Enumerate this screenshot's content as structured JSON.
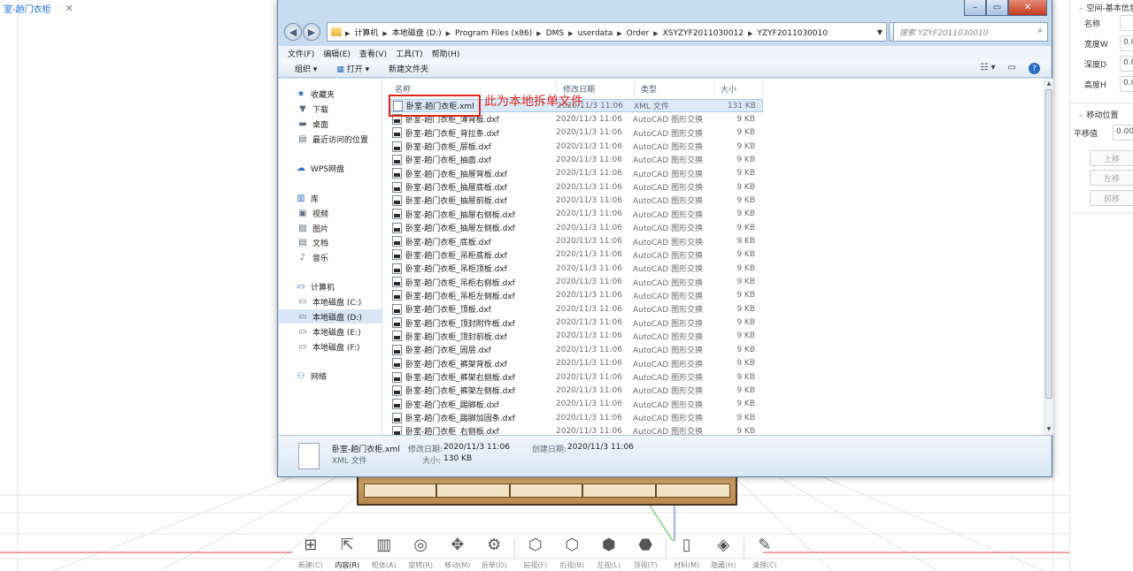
{
  "app": {
    "doc_tab": {
      "label": "室-趟门衣柜",
      "close": "✕"
    },
    "toolbar": [
      {
        "label": "新建(C)",
        "icon": "add-frame-icon",
        "glyph": "⊞"
      },
      {
        "label": "内容(R)",
        "icon": "select-cursor-icon",
        "glyph": "⇱",
        "active": true
      },
      {
        "label": "柜体(A)",
        "icon": "cabinet-icon",
        "glyph": "▥"
      },
      {
        "label": "旋转(R)",
        "icon": "rotate-icon",
        "glyph": "◎"
      },
      {
        "label": "移动(M)",
        "icon": "move-icon",
        "glyph": "✥"
      },
      {
        "label": "拆单(D)",
        "icon": "split-icon",
        "glyph": "⚙"
      },
      {
        "label": "前视(F)",
        "icon": "front-view-icon",
        "glyph": "⬡"
      },
      {
        "label": "后视(B)",
        "icon": "back-view-icon",
        "glyph": "⬡"
      },
      {
        "label": "左视(L)",
        "icon": "left-view-icon",
        "glyph": "⬢"
      },
      {
        "label": "顶视(T)",
        "icon": "top-view-icon",
        "glyph": "⬣"
      },
      {
        "label": "材料(M)",
        "icon": "material-icon",
        "glyph": "▯"
      },
      {
        "label": "隐藏(H)",
        "icon": "layers-icon",
        "glyph": "◈"
      },
      {
        "label": "清理(C)",
        "icon": "brush-icon",
        "glyph": "✎"
      }
    ]
  },
  "prop_panel": {
    "section1_title": "空间-基本信息",
    "fields": [
      {
        "label": "名称",
        "value": ""
      },
      {
        "label": "宽度W",
        "value": "0.0"
      },
      {
        "label": "深度D",
        "value": "0.0"
      },
      {
        "label": "高度H",
        "value": "0.0"
      }
    ],
    "section2_title": "移动位置",
    "offset_label": "平移值",
    "offset_value": "0.00",
    "buttons": [
      "上移",
      "左移",
      "前移"
    ]
  },
  "explorer": {
    "window_controls": {
      "min": "–",
      "max": "▭",
      "close": "✕"
    },
    "breadcrumbs": [
      "计算机",
      "本地磁盘 (D:)",
      "Program Files (x86)",
      "DMS",
      "userdata",
      "Order",
      "XSYZYF2011030012",
      "YZYF2011030010"
    ],
    "search_placeholder": "搜索 YZYF2011030010",
    "menu": [
      "文件(F)",
      "编辑(E)",
      "查看(V)",
      "工具(T)",
      "帮助(H)"
    ],
    "commands": {
      "organize": "组织 ▾",
      "open": "打开 ▾",
      "new_folder": "新建文件夹"
    },
    "nav": [
      {
        "label": "收藏夹",
        "icon": "star-icon",
        "glyph": "★",
        "head": true
      },
      {
        "label": "下载",
        "icon": "download-folder-icon",
        "glyph": "▼"
      },
      {
        "label": "桌面",
        "icon": "desktop-icon",
        "glyph": "▬"
      },
      {
        "label": "最近访问的位置",
        "icon": "recent-places-icon",
        "glyph": "▤"
      },
      {
        "label": "WPS网盘",
        "icon": "cloud-icon",
        "glyph": "☁",
        "head": true
      },
      {
        "label": "库",
        "icon": "library-icon",
        "glyph": "▥",
        "head": true
      },
      {
        "label": "视频",
        "icon": "video-icon",
        "glyph": "▣"
      },
      {
        "label": "图片",
        "icon": "picture-icon",
        "glyph": "▨"
      },
      {
        "label": "文档",
        "icon": "document-icon",
        "glyph": "▤"
      },
      {
        "label": "音乐",
        "icon": "music-icon",
        "glyph": "♪"
      },
      {
        "label": "计算机",
        "icon": "computer-icon",
        "glyph": "▭",
        "head": true
      },
      {
        "label": "本地磁盘 (C:)",
        "icon": "drive-icon",
        "glyph": "▭"
      },
      {
        "label": "本地磁盘 (D:)",
        "icon": "drive-icon",
        "glyph": "▭",
        "selected": true
      },
      {
        "label": "本地磁盘 (E:)",
        "icon": "drive-icon",
        "glyph": "▭"
      },
      {
        "label": "本地磁盘 (F:)",
        "icon": "drive-icon",
        "glyph": "▭"
      },
      {
        "label": "网络",
        "icon": "network-icon",
        "glyph": "⚇",
        "head": true
      }
    ],
    "columns": {
      "name": "名称",
      "date": "修改日期",
      "type": "类型",
      "size": "大小"
    },
    "files": [
      {
        "name": "卧室-趟门衣柜.xml",
        "date": "2020/11/3 11:06",
        "type": "XML 文件",
        "size": "131 KB",
        "kind": "xml",
        "selected": true
      },
      {
        "name": "卧室-趟门衣柜_薄背板.dxf",
        "date": "2020/11/3 11:06",
        "type": "AutoCAD 图形交换",
        "size": "9 KB",
        "kind": "dxf"
      },
      {
        "name": "卧室-趟门衣柜_背拉条.dxf",
        "date": "2020/11/3 11:06",
        "type": "AutoCAD 图形交换",
        "size": "9 KB",
        "kind": "dxf"
      },
      {
        "name": "卧室-趟门衣柜_层板.dxf",
        "date": "2020/11/3 11:06",
        "type": "AutoCAD 图形交换",
        "size": "9 KB",
        "kind": "dxf"
      },
      {
        "name": "卧室-趟门衣柜_抽面.dxf",
        "date": "2020/11/3 11:06",
        "type": "AutoCAD 图形交换",
        "size": "9 KB",
        "kind": "dxf"
      },
      {
        "name": "卧室-趟门衣柜_抽屉背板.dxf",
        "date": "2020/11/3 11:06",
        "type": "AutoCAD 图形交换",
        "size": "9 KB",
        "kind": "dxf"
      },
      {
        "name": "卧室-趟门衣柜_抽屉底板.dxf",
        "date": "2020/11/3 11:06",
        "type": "AutoCAD 图形交换",
        "size": "9 KB",
        "kind": "dxf"
      },
      {
        "name": "卧室-趟门衣柜_抽屉前板.dxf",
        "date": "2020/11/3 11:06",
        "type": "AutoCAD 图形交换",
        "size": "9 KB",
        "kind": "dxf"
      },
      {
        "name": "卧室-趟门衣柜_抽屉右侧板.dxf",
        "date": "2020/11/3 11:06",
        "type": "AutoCAD 图形交换",
        "size": "9 KB",
        "kind": "dxf"
      },
      {
        "name": "卧室-趟门衣柜_抽屉左侧板.dxf",
        "date": "2020/11/3 11:06",
        "type": "AutoCAD 图形交换",
        "size": "9 KB",
        "kind": "dxf"
      },
      {
        "name": "卧室-趟门衣柜_底板.dxf",
        "date": "2020/11/3 11:06",
        "type": "AutoCAD 图形交换",
        "size": "9 KB",
        "kind": "dxf"
      },
      {
        "name": "卧室-趟门衣柜_吊柜底板.dxf",
        "date": "2020/11/3 11:06",
        "type": "AutoCAD 图形交换",
        "size": "9 KB",
        "kind": "dxf"
      },
      {
        "name": "卧室-趟门衣柜_吊柜顶板.dxf",
        "date": "2020/11/3 11:06",
        "type": "AutoCAD 图形交换",
        "size": "9 KB",
        "kind": "dxf"
      },
      {
        "name": "卧室-趟门衣柜_吊柜右侧板.dxf",
        "date": "2020/11/3 11:06",
        "type": "AutoCAD 图形交换",
        "size": "9 KB",
        "kind": "dxf"
      },
      {
        "name": "卧室-趟门衣柜_吊柜左侧板.dxf",
        "date": "2020/11/3 11:06",
        "type": "AutoCAD 图形交换",
        "size": "9 KB",
        "kind": "dxf"
      },
      {
        "name": "卧室-趟门衣柜_顶板.dxf",
        "date": "2020/11/3 11:06",
        "type": "AutoCAD 图形交换",
        "size": "9 KB",
        "kind": "dxf"
      },
      {
        "name": "卧室-趟门衣柜_顶封附件板.dxf",
        "date": "2020/11/3 11:06",
        "type": "AutoCAD 图形交换",
        "size": "9 KB",
        "kind": "dxf"
      },
      {
        "name": "卧室-趟门衣柜_顶封前板.dxf",
        "date": "2020/11/3 11:06",
        "type": "AutoCAD 图形交换",
        "size": "9 KB",
        "kind": "dxf"
      },
      {
        "name": "卧室-趟门衣柜_固层.dxf",
        "date": "2020/11/3 11:06",
        "type": "AutoCAD 图形交换",
        "size": "9 KB",
        "kind": "dxf"
      },
      {
        "name": "卧室-趟门衣柜_裤架背板.dxf",
        "date": "2020/11/3 11:06",
        "type": "AutoCAD 图形交换",
        "size": "9 KB",
        "kind": "dxf"
      },
      {
        "name": "卧室-趟门衣柜_裤架右侧板.dxf",
        "date": "2020/11/3 11:06",
        "type": "AutoCAD 图形交换",
        "size": "9 KB",
        "kind": "dxf"
      },
      {
        "name": "卧室-趟门衣柜_裤架左侧板.dxf",
        "date": "2020/11/3 11:06",
        "type": "AutoCAD 图形交换",
        "size": "9 KB",
        "kind": "dxf"
      },
      {
        "name": "卧室-趟门衣柜_踢脚板.dxf",
        "date": "2020/11/3 11:06",
        "type": "AutoCAD 图形交换",
        "size": "9 KB",
        "kind": "dxf"
      },
      {
        "name": "卧室-趟门衣柜_踢脚加固条.dxf",
        "date": "2020/11/3 11:06",
        "type": "AutoCAD 图形交换",
        "size": "9 KB",
        "kind": "dxf"
      },
      {
        "name": "卧室-趟门衣柜_右侧板.dxf",
        "date": "2020/11/3 11:06",
        "type": "AutoCAD 图形交换",
        "size": "9 KB",
        "kind": "dxf"
      }
    ],
    "details": {
      "name": "卧室-趟门衣柜.xml",
      "mod_label": "修改日期:",
      "mod_value": "2020/11/3 11:06",
      "create_label": "创建日期:",
      "create_value": "2020/11/3 11:06",
      "type": "XML 文件",
      "size_label": "大小:",
      "size_value": "130 KB"
    }
  },
  "annotation": {
    "text": "此为本地拆单文件",
    "color": "#e0261a"
  },
  "colors": {
    "accent": "#1a6fd6",
    "highlight": "#e0261a",
    "window_frame": "#c8dcf1"
  }
}
